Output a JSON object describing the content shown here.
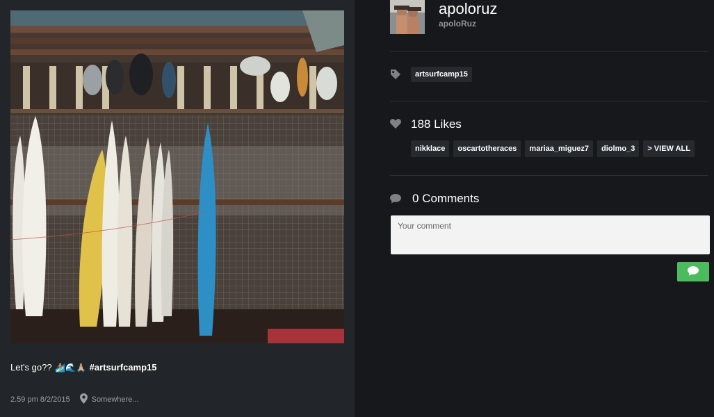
{
  "post": {
    "caption_text": "Let's go?? ",
    "caption_emoji": "🏄🏼🌊🙏🏼",
    "caption_hashtag": "#artsurfcamp15",
    "time": "2.59 pm 8/2/2015",
    "location": "Somewhere..."
  },
  "user": {
    "name": "apoloruz",
    "handle": "apoloRuz"
  },
  "tags": {
    "icon": "tag-icon",
    "items": [
      "artsurfcamp15"
    ]
  },
  "likes": {
    "icon": "heart-icon",
    "label": "188 Likes",
    "users": [
      "nikklace",
      "oscartotheraces",
      "mariaa_miguez7",
      "diolmo_3"
    ],
    "view_all": "> VIEW ALL"
  },
  "comments": {
    "icon": "speech-bubble-icon",
    "label": "0 Comments",
    "placeholder": "Your comment",
    "send_icon": "comment-send-icon",
    "send_color": "#4cbb5d"
  }
}
